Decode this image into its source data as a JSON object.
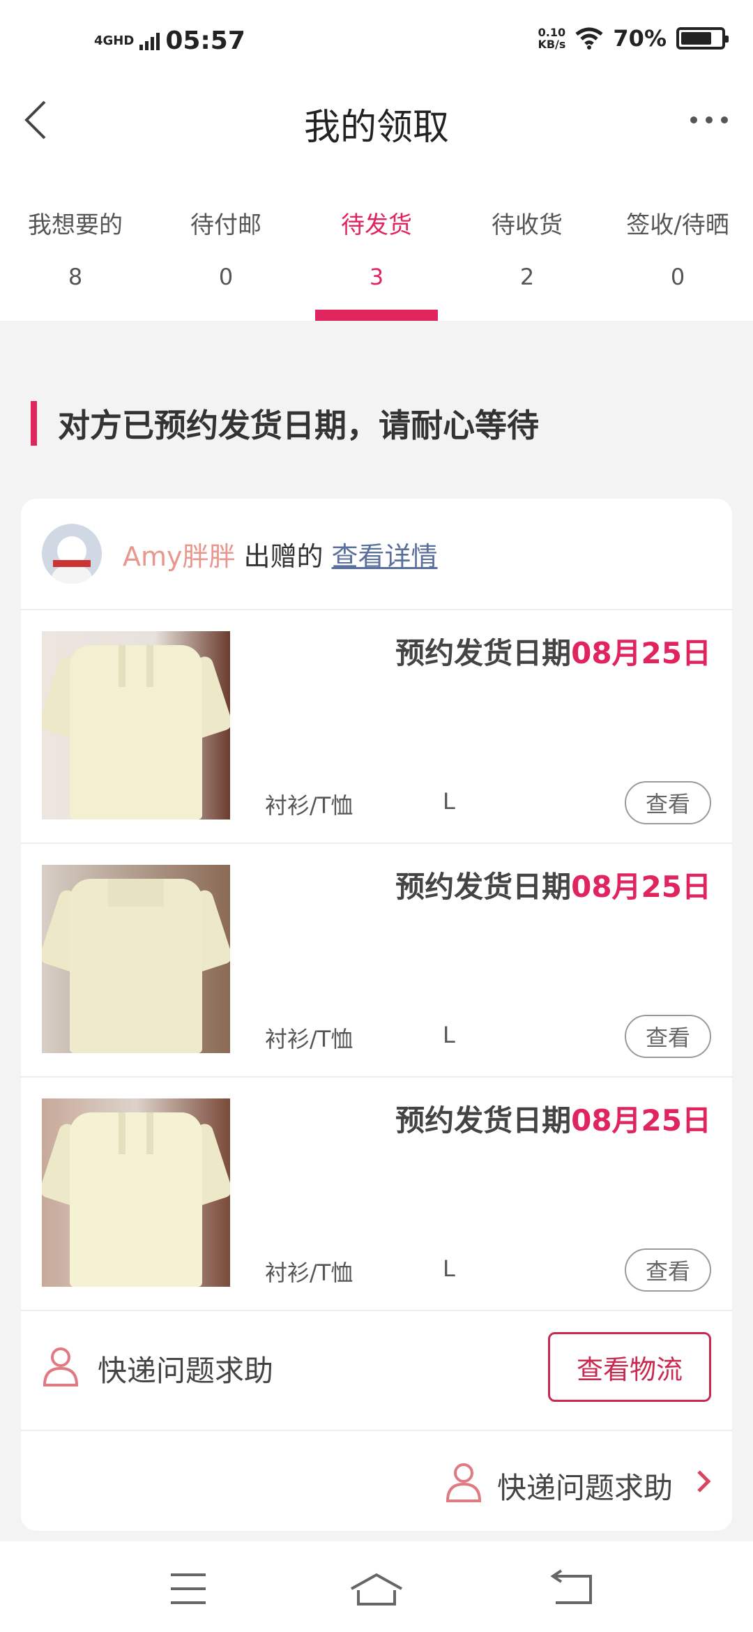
{
  "status_bar": {
    "network": "4GHD",
    "time": "05:57",
    "speed_value": "0.10",
    "speed_unit": "KB/s",
    "battery": "70%"
  },
  "header": {
    "title": "我的领取",
    "back_icon": "chevron-left-icon",
    "more_icon": "more-horizontal-icon"
  },
  "tabs": [
    {
      "label": "我想要的",
      "count": "8"
    },
    {
      "label": "待付邮",
      "count": "0"
    },
    {
      "label": "待发货",
      "count": "3",
      "active": true
    },
    {
      "label": "待收货",
      "count": "2"
    },
    {
      "label": "签收/待晒",
      "count": "0"
    }
  ],
  "notice": "对方已预约发货日期，请耐心等待",
  "card": {
    "owner": {
      "name": "Amy胖胖",
      "gave_text": "出赠的",
      "detail_link": "查看详情"
    },
    "items": [
      {
        "ship_label": "预约发货日期",
        "ship_date": "08月25日",
        "category": "衬衫/T恤",
        "size": "L",
        "view_button": "查看"
      },
      {
        "ship_label": "预约发货日期",
        "ship_date": "08月25日",
        "category": "衬衫/T恤",
        "size": "L",
        "view_button": "查看"
      },
      {
        "ship_label": "预约发货日期",
        "ship_date": "08月25日",
        "category": "衬衫/T恤",
        "size": "L",
        "view_button": "查看"
      }
    ],
    "help_label": "快递问题求助",
    "logistics_button": "查看物流",
    "help_link": "快递问题求助"
  },
  "colors": {
    "accent": "#e0245e",
    "owner_name": "#e8978f",
    "link": "#5a6f9c"
  }
}
